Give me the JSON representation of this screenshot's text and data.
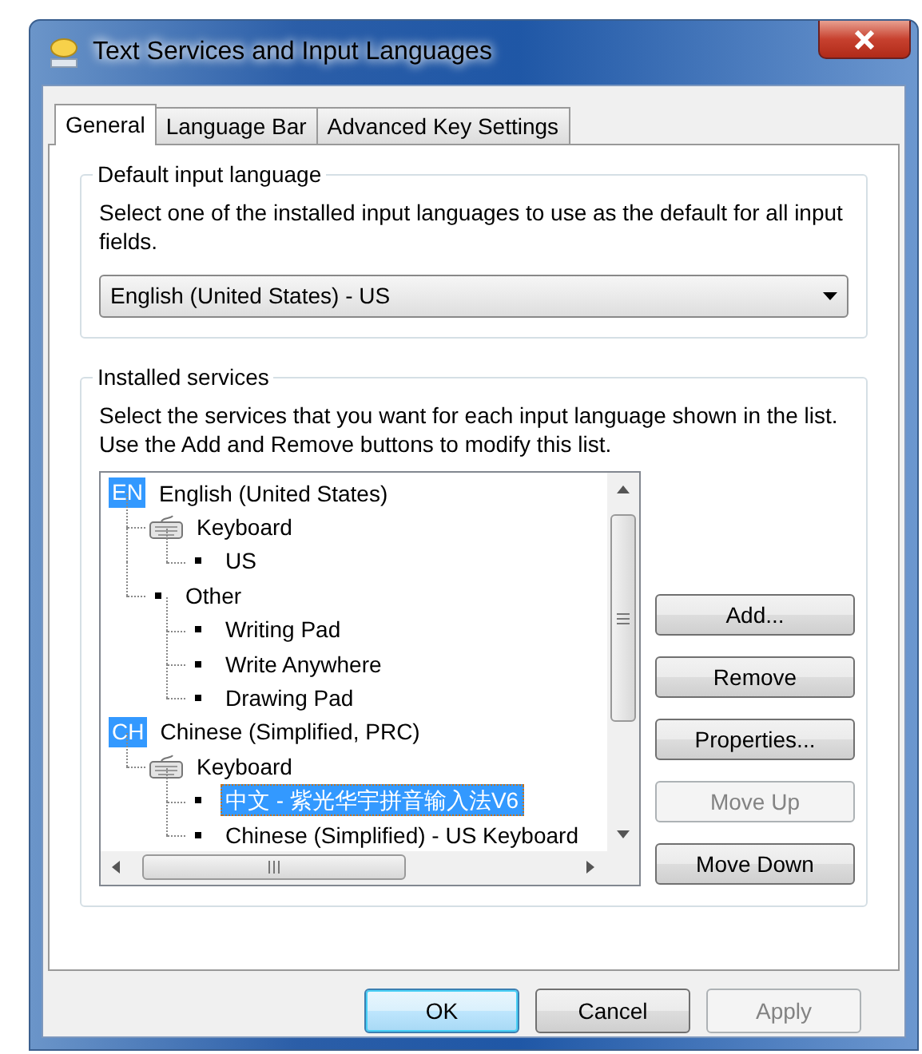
{
  "window": {
    "title": "Text Services and Input Languages"
  },
  "tabs": [
    {
      "label": "General",
      "selected": true
    },
    {
      "label": "Language Bar",
      "selected": false
    },
    {
      "label": "Advanced Key Settings",
      "selected": false
    }
  ],
  "default_input_language": {
    "heading": "Default input language",
    "description": "Select one of the installed input languages to use as the default for all input fields.",
    "dropdown": {
      "value": "English (United States) - US"
    }
  },
  "installed_services": {
    "heading": "Installed services",
    "description": "Select the services that you want for each input language shown in the list. Use the Add and Remove buttons to modify this list.",
    "tree": [
      {
        "kind": "language",
        "badge": "EN",
        "label": "English (United States)",
        "selected": false,
        "children": [
          {
            "kind": "keyboard",
            "label": "Keyboard",
            "selected": false,
            "children": [
              {
                "kind": "service",
                "label": "US",
                "selected": false
              }
            ]
          },
          {
            "kind": "group",
            "label": "Other",
            "selected": false,
            "children": [
              {
                "kind": "service",
                "label": "Writing Pad",
                "selected": false
              },
              {
                "kind": "service",
                "label": "Write Anywhere",
                "selected": false
              },
              {
                "kind": "service",
                "label": "Drawing Pad",
                "selected": false
              }
            ]
          }
        ]
      },
      {
        "kind": "language",
        "badge": "CH",
        "label": "Chinese (Simplified, PRC)",
        "selected": false,
        "children": [
          {
            "kind": "keyboard",
            "label": "Keyboard",
            "selected": false,
            "children": [
              {
                "kind": "service",
                "label": "中文 - 紫光华宇拼音输入法V6",
                "selected": true
              },
              {
                "kind": "service",
                "label": "Chinese (Simplified) - US Keyboard",
                "selected": false
              }
            ]
          }
        ]
      }
    ],
    "buttons": [
      {
        "label": "Add...",
        "disabled": false
      },
      {
        "label": "Remove",
        "disabled": false
      },
      {
        "label": "Properties...",
        "disabled": false
      },
      {
        "label": "Move Up",
        "disabled": true
      },
      {
        "label": "Move Down",
        "disabled": false
      }
    ]
  },
  "dialog_buttons": [
    {
      "label": "OK",
      "default": true,
      "disabled": false
    },
    {
      "label": "Cancel",
      "default": false,
      "disabled": false
    },
    {
      "label": "Apply",
      "default": false,
      "disabled": true
    }
  ]
}
